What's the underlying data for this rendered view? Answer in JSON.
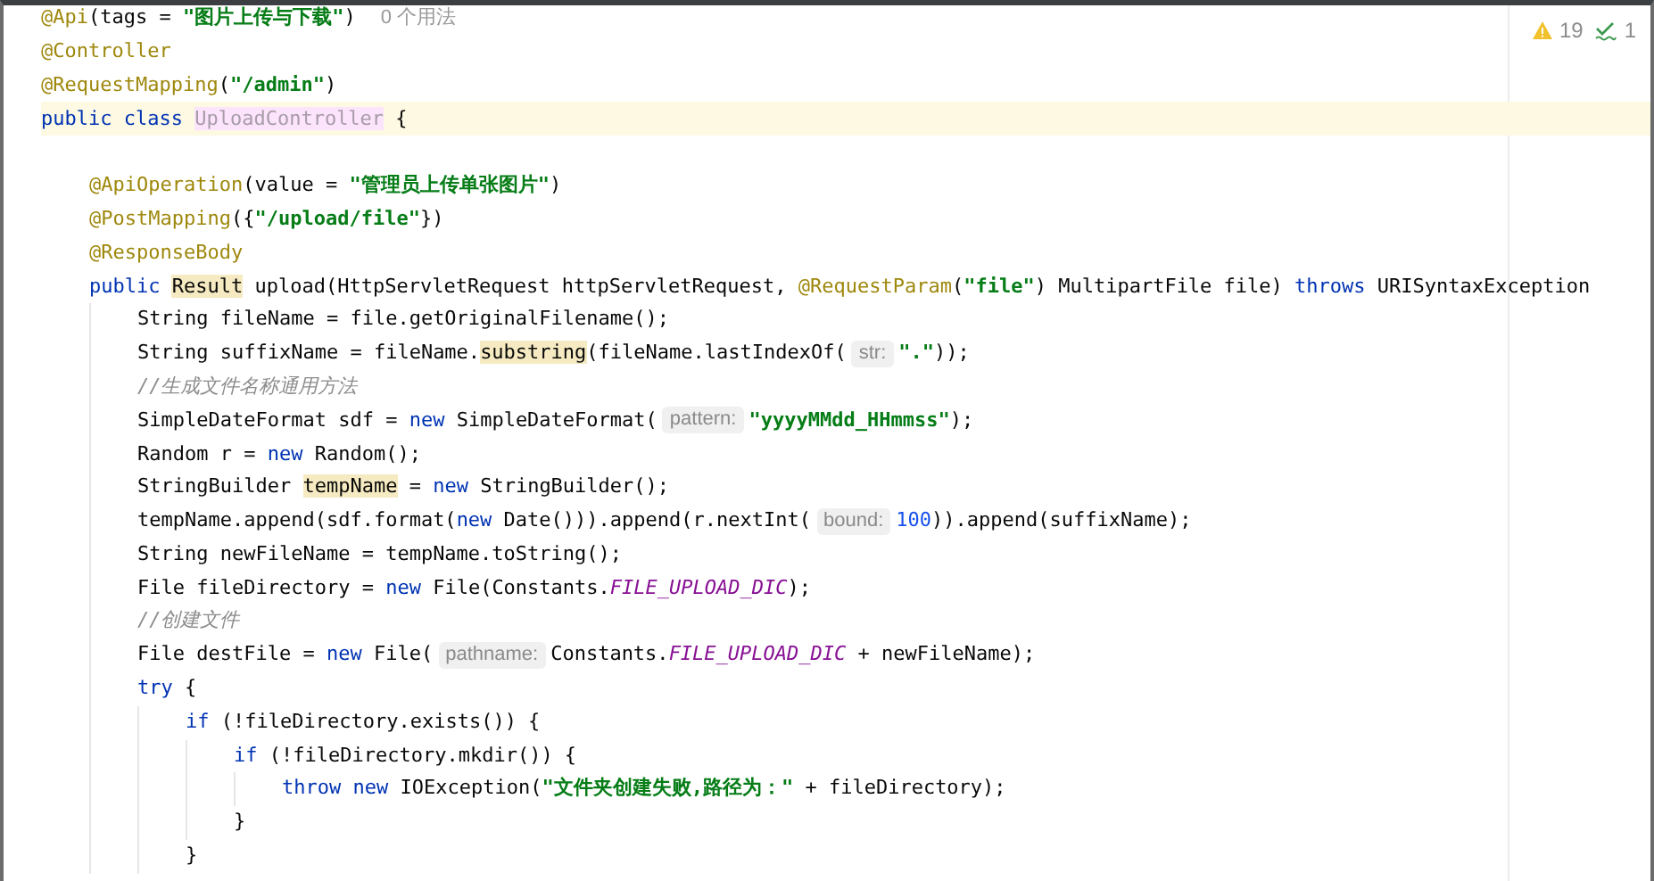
{
  "inspections": {
    "warnings": "19",
    "weak_warnings": "1"
  },
  "lines": [
    {
      "current": false,
      "tokens": [
        {
          "kind": "annotation",
          "text": "@Api"
        },
        {
          "kind": "plain",
          "text": "(tags = "
        },
        {
          "kind": "string",
          "text": "\"图片上传与下载\""
        },
        {
          "kind": "plain",
          "text": ")"
        },
        {
          "kind": "usages",
          "text": "0 个用法"
        }
      ]
    },
    {
      "current": false,
      "tokens": [
        {
          "kind": "annotation",
          "text": "@Controller"
        }
      ]
    },
    {
      "current": false,
      "tokens": [
        {
          "kind": "annotation",
          "text": "@RequestMapping"
        },
        {
          "kind": "plain",
          "text": "("
        },
        {
          "kind": "string",
          "text": "\"/admin\""
        },
        {
          "kind": "plain",
          "text": ")"
        }
      ]
    },
    {
      "current": true,
      "tokens": [
        {
          "kind": "keyword",
          "text": "public class "
        },
        {
          "kind": "unused_class",
          "text": "UploadController"
        },
        {
          "kind": "plain",
          "text": " {"
        }
      ],
      "children": [
        {
          "current": false
        },
        {
          "current": false,
          "tokens": [
            {
              "kind": "annotation",
              "text": "@ApiOperation"
            },
            {
              "kind": "plain",
              "text": "(value = "
            },
            {
              "kind": "string",
              "text": "\"管理员上传单张图片\""
            },
            {
              "kind": "plain",
              "text": ")"
            }
          ]
        },
        {
          "current": false,
          "tokens": [
            {
              "kind": "annotation",
              "text": "@PostMapping"
            },
            {
              "kind": "plain",
              "text": "({"
            },
            {
              "kind": "string",
              "text": "\"/upload/file\""
            },
            {
              "kind": "plain",
              "text": "})"
            }
          ]
        },
        {
          "current": false,
          "tokens": [
            {
              "kind": "annotation",
              "text": "@ResponseBody"
            }
          ]
        },
        {
          "current": false,
          "tokens": [
            {
              "kind": "keyword",
              "text": "public "
            },
            {
              "kind": "highlight",
              "text": "Result"
            },
            {
              "kind": "plain",
              "text": " upload(HttpServletRequest httpServletRequest, "
            },
            {
              "kind": "annotation",
              "text": "@RequestParam"
            },
            {
              "kind": "plain",
              "text": "("
            },
            {
              "kind": "string",
              "text": "\"file\""
            },
            {
              "kind": "plain",
              "text": ") MultipartFile file) "
            },
            {
              "kind": "keyword",
              "text": "throws"
            },
            {
              "kind": "plain",
              "text": " URISyntaxException"
            }
          ],
          "children": [
            {
              "current": false,
              "tokens": [
                {
                  "kind": "plain",
                  "text": "String fileName = file.getOriginalFilename();"
                }
              ]
            },
            {
              "current": false,
              "tokens": [
                {
                  "kind": "plain",
                  "text": "String suffixName = fileName."
                },
                {
                  "kind": "highlight",
                  "text": "substring"
                },
                {
                  "kind": "plain",
                  "text": "(fileName.lastIndexOf("
                },
                {
                  "kind": "hint",
                  "text": "str:"
                },
                {
                  "kind": "string",
                  "text": "\".\""
                },
                {
                  "kind": "plain",
                  "text": "));"
                }
              ]
            },
            {
              "current": false,
              "tokens": [
                {
                  "kind": "comment",
                  "text": "//生成文件名称通用方法"
                }
              ]
            },
            {
              "current": false,
              "tokens": [
                {
                  "kind": "plain",
                  "text": "SimpleDateFormat sdf = "
                },
                {
                  "kind": "keyword",
                  "text": "new"
                },
                {
                  "kind": "plain",
                  "text": " SimpleDateFormat("
                },
                {
                  "kind": "hint",
                  "text": "pattern:"
                },
                {
                  "kind": "string",
                  "text": "\"yyyyMMdd_HHmmss\""
                },
                {
                  "kind": "plain",
                  "text": ");"
                }
              ]
            },
            {
              "current": false,
              "tokens": [
                {
                  "kind": "plain",
                  "text": "Random r = "
                },
                {
                  "kind": "keyword",
                  "text": "new"
                },
                {
                  "kind": "plain",
                  "text": " Random();"
                }
              ]
            },
            {
              "current": false,
              "tokens": [
                {
                  "kind": "plain",
                  "text": "StringBuilder "
                },
                {
                  "kind": "highlight",
                  "text": "tempName"
                },
                {
                  "kind": "plain",
                  "text": " = "
                },
                {
                  "kind": "keyword",
                  "text": "new"
                },
                {
                  "kind": "plain",
                  "text": " StringBuilder();"
                }
              ]
            },
            {
              "current": false,
              "tokens": [
                {
                  "kind": "plain",
                  "text": "tempName.append(sdf.format("
                },
                {
                  "kind": "keyword",
                  "text": "new"
                },
                {
                  "kind": "plain",
                  "text": " Date())).append(r.nextInt("
                },
                {
                  "kind": "hint",
                  "text": "bound:"
                },
                {
                  "kind": "number",
                  "text": "100"
                },
                {
                  "kind": "plain",
                  "text": ")).append(suffixName);"
                }
              ]
            },
            {
              "current": false,
              "tokens": [
                {
                  "kind": "plain",
                  "text": "String newFileName = tempName.toString();"
                }
              ]
            },
            {
              "current": false,
              "tokens": [
                {
                  "kind": "plain",
                  "text": "File fileDirectory = "
                },
                {
                  "kind": "keyword",
                  "text": "new"
                },
                {
                  "kind": "plain",
                  "text": " File(Constants."
                },
                {
                  "kind": "constant",
                  "text": "FILE_UPLOAD_DIC"
                },
                {
                  "kind": "plain",
                  "text": ");"
                }
              ]
            },
            {
              "current": false,
              "tokens": [
                {
                  "kind": "comment",
                  "text": "//创建文件"
                }
              ]
            },
            {
              "current": false,
              "tokens": [
                {
                  "kind": "plain",
                  "text": "File destFile = "
                },
                {
                  "kind": "keyword",
                  "text": "new"
                },
                {
                  "kind": "plain",
                  "text": " File("
                },
                {
                  "kind": "hint",
                  "text": "pathname:"
                },
                {
                  "kind": "plain",
                  "text": "Constants."
                },
                {
                  "kind": "constant",
                  "text": "FILE_UPLOAD_DIC"
                },
                {
                  "kind": "plain",
                  "text": " + newFileName);"
                }
              ]
            },
            {
              "current": false,
              "tokens": [
                {
                  "kind": "keyword",
                  "text": "try"
                },
                {
                  "kind": "plain",
                  "text": " {"
                }
              ],
              "children": [
                {
                  "current": false,
                  "tokens": [
                    {
                      "kind": "keyword",
                      "text": "if"
                    },
                    {
                      "kind": "plain",
                      "text": " (!fileDirectory.exists()) {"
                    }
                  ],
                  "children": [
                    {
                      "current": false,
                      "tokens": [
                        {
                          "kind": "keyword",
                          "text": "if"
                        },
                        {
                          "kind": "plain",
                          "text": " (!fileDirectory.mkdir()) {"
                        }
                      ],
                      "children": [
                        {
                          "current": false,
                          "tokens": [
                            {
                              "kind": "keyword",
                              "text": "throw "
                            },
                            {
                              "kind": "keyword",
                              "text": "new"
                            },
                            {
                              "kind": "plain",
                              "text": " IOException("
                            },
                            {
                              "kind": "string",
                              "text": "\"文件夹创建失败,路径为：\""
                            },
                            {
                              "kind": "plain",
                              "text": " + fileDirectory);"
                            }
                          ]
                        }
                      ]
                    },
                    {
                      "current": false,
                      "tokens": [
                        {
                          "kind": "plain",
                          "text": "}"
                        }
                      ]
                    }
                  ]
                },
                {
                  "current": false,
                  "tokens": [
                    {
                      "kind": "plain",
                      "text": "}"
                    }
                  ]
                }
              ]
            }
          ]
        }
      ]
    }
  ]
}
